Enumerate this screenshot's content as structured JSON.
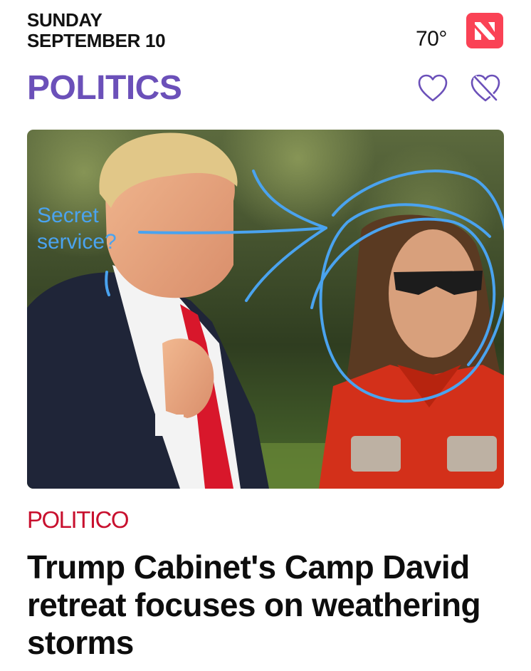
{
  "header": {
    "day": "SUNDAY",
    "date": "SEPTEMBER 10",
    "temperature": "70°",
    "app_icon": "news-icon"
  },
  "section": {
    "title": "POLITICS",
    "follow_icon": "heart-icon",
    "block_icon": "heart-slash-icon"
  },
  "article": {
    "image": {
      "annotation_text_line1": "Secret",
      "annotation_text_line2": "service?",
      "annotation_color": "#4aa3ef"
    },
    "publisher": "POLITICO",
    "headline": "Trump Cabinet's Camp David retreat focuses on weathering storms"
  },
  "colors": {
    "section_accent": "#6b50b9",
    "publisher_red": "#c8102e",
    "news_icon_bg": "#fa4255"
  }
}
